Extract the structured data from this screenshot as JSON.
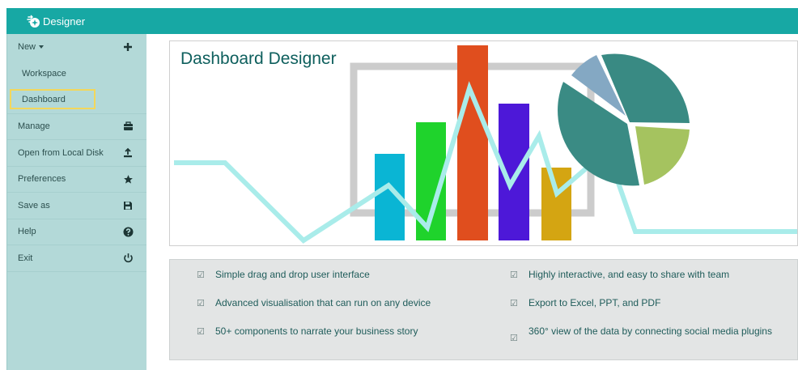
{
  "app": {
    "brand": "Designer",
    "accent_color": "#17a8a4",
    "sidebar_color": "#b3d9d8"
  },
  "sidebar": {
    "new_label": "New",
    "sub_items": [
      {
        "label": "Workspace"
      },
      {
        "label": "Dashboard",
        "selected": true
      }
    ],
    "items": [
      {
        "label": "Manage",
        "icon": "briefcase-icon"
      },
      {
        "label": "Open from Local Disk",
        "icon": "upload-icon"
      },
      {
        "label": "Preferences",
        "icon": "star-icon"
      },
      {
        "label": "Save as",
        "icon": "save-icon"
      },
      {
        "label": "Help",
        "icon": "help-icon"
      },
      {
        "label": "Exit",
        "icon": "power-icon"
      }
    ]
  },
  "banner": {
    "title": "Dashboard Designer"
  },
  "features": [
    "Simple drag and drop user interface",
    "Highly interactive, and easy to share with team",
    "Advanced visualisation that can run on any device",
    "Export to Excel, PPT, and PDF",
    "50+ components to narrate your business story",
    "360° view of the data by connecting social media plugins"
  ]
}
